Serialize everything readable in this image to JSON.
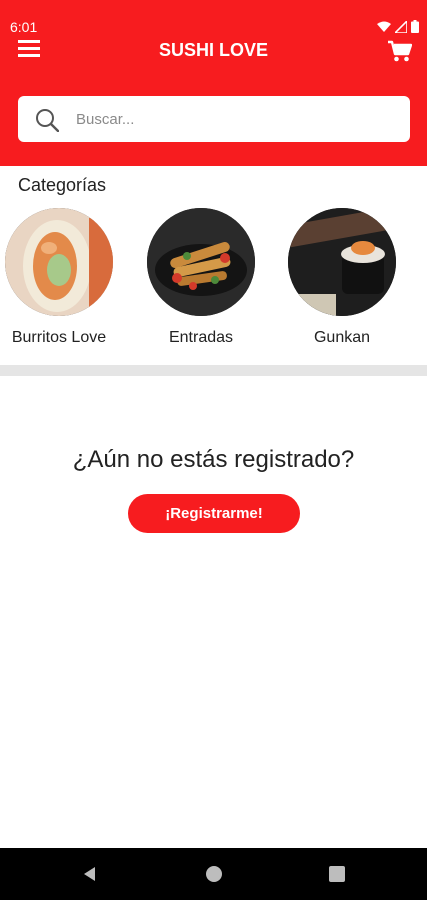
{
  "status_bar": {
    "time": "6:01",
    "icons": [
      "wifi-icon",
      "signal-icon",
      "battery-icon"
    ]
  },
  "header": {
    "title": "SUSHI LOVE",
    "menu_icon": "menu-icon",
    "cart_icon": "cart-icon"
  },
  "search": {
    "placeholder": "Buscar...",
    "value": "",
    "icon": "search-icon"
  },
  "categories": {
    "title": "Categorías",
    "items": [
      {
        "label": "Burritos Love"
      },
      {
        "label": "Entradas"
      },
      {
        "label": "Gunkan"
      }
    ]
  },
  "register": {
    "question": "¿Aún no estás registrado?",
    "button_label": "¡Registrarme!"
  },
  "nav_bar": {
    "buttons": [
      "back-icon",
      "home-icon",
      "recents-icon"
    ]
  },
  "colors": {
    "brand_red": "#f71c1f",
    "divider": "#e5e5e5",
    "text": "#222222"
  }
}
